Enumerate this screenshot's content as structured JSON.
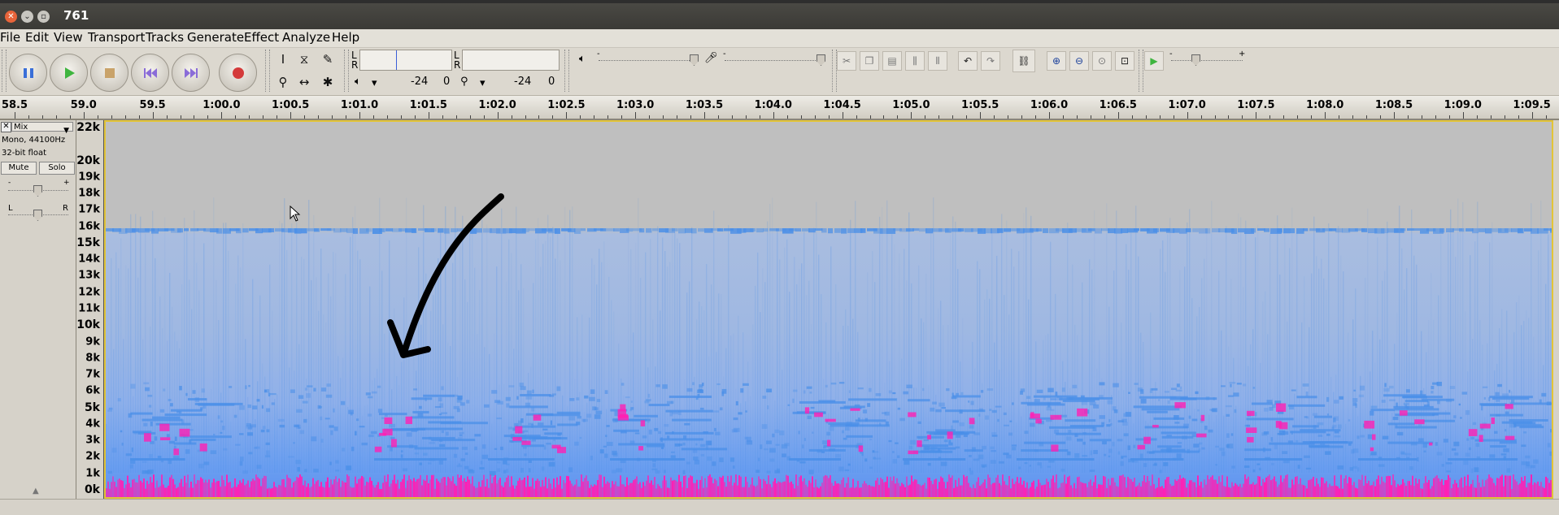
{
  "window": {
    "title": "761"
  },
  "menu": [
    "File",
    "Edit",
    "View",
    "Transport",
    "Tracks",
    "Generate",
    "Effect",
    "Analyze",
    "Help"
  ],
  "meters": {
    "playback": {
      "l": "L",
      "r": "R",
      "db_left": "-24",
      "db_right": "0"
    },
    "record": {
      "l": "L",
      "r": "R",
      "db_left": "-24",
      "db_right": "0"
    }
  },
  "sliders": {
    "minus": "-",
    "plus": "+"
  },
  "ruler": {
    "labels": [
      "58.5",
      "59.0",
      "59.5",
      "1:00.0",
      "1:00.5",
      "1:01.0",
      "1:01.5",
      "1:02.0",
      "1:02.5",
      "1:03.0",
      "1:03.5",
      "1:04.0",
      "1:04.5",
      "1:05.0",
      "1:05.5",
      "1:06.0",
      "1:06.5",
      "1:07.0",
      "1:07.5",
      "1:08.0",
      "1:08.5",
      "1:09.0",
      "1:09.5"
    ]
  },
  "track": {
    "close": "✕",
    "name": "Mix",
    "format": "Mono, 44100Hz",
    "sample_format": "32-bit float",
    "mute": "Mute",
    "solo": "Solo",
    "gain_minus": "-",
    "gain_plus": "+",
    "pan_left": "L",
    "pan_right": "R"
  },
  "freq_axis": {
    "labels": [
      "22k",
      "20k",
      "19k",
      "18k",
      "17k",
      "16k",
      "15k",
      "14k",
      "13k",
      "12k",
      "11k",
      "10k",
      "9k",
      "8k",
      "7k",
      "6k",
      "5k",
      "4k",
      "3k",
      "2k",
      "1k",
      "0k"
    ],
    "major": [
      "22k",
      "20k",
      "15k",
      "10k",
      "5k",
      "0k"
    ]
  },
  "colors": {
    "spectro_bg": "#bfbfbf",
    "spectro_blue": "#4a8fe8",
    "spectro_magenta": "#ff1fb4",
    "selection_border": "#e2c437"
  }
}
